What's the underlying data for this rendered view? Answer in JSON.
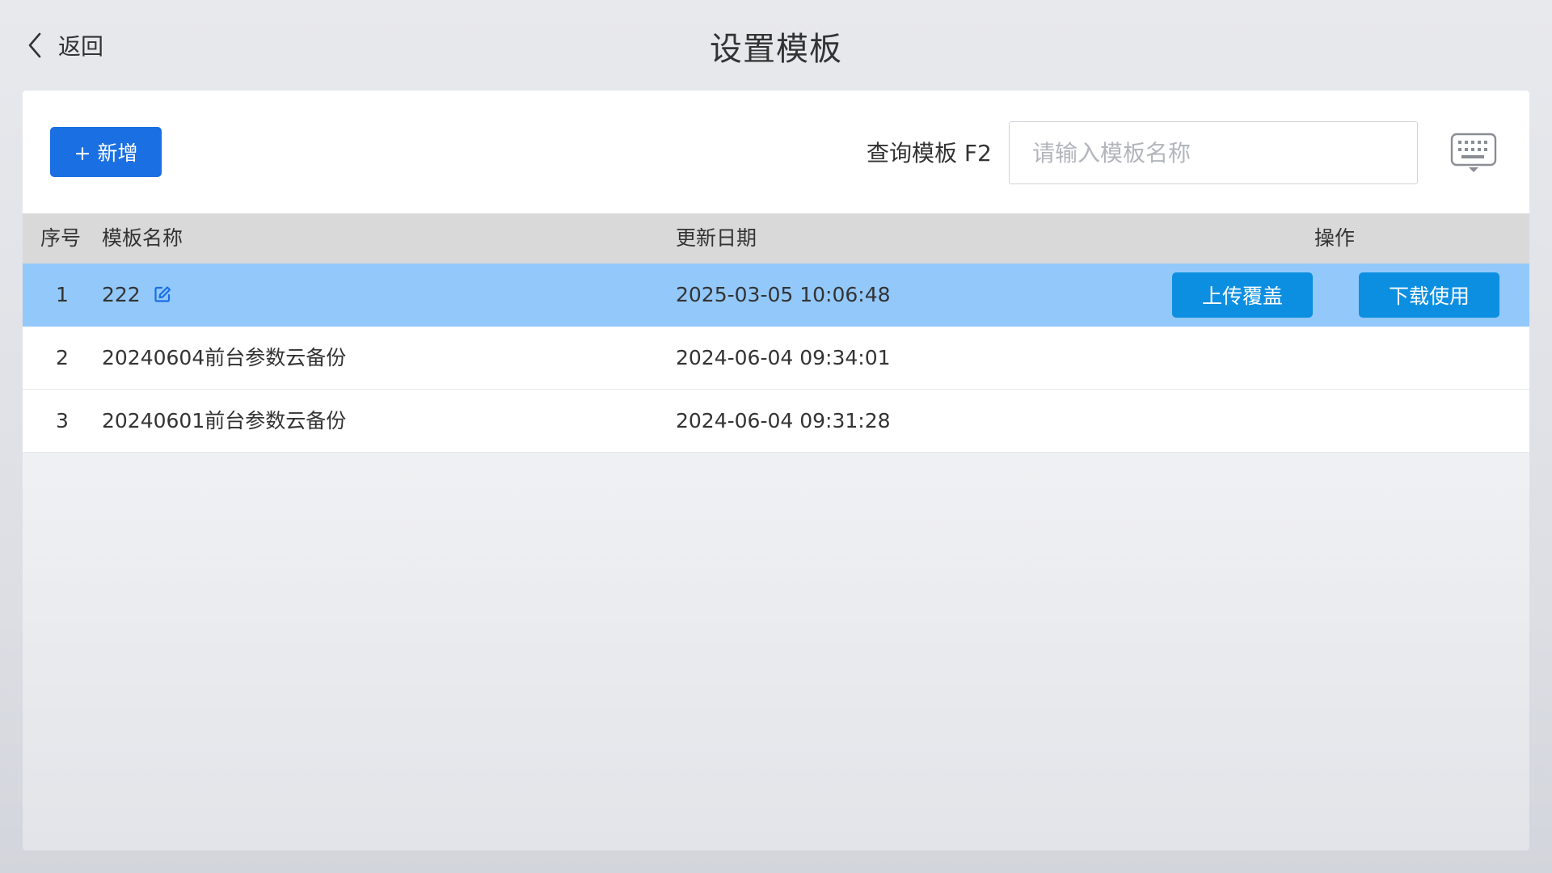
{
  "header": {
    "back_label": "返回",
    "title": "设置模板"
  },
  "toolbar": {
    "add_label": "+ 新增",
    "search_label": "查询模板 F2",
    "search_placeholder": "请输入模板名称",
    "search_value": "",
    "keyboard_icon": "keyboard-icon"
  },
  "table": {
    "columns": [
      "序号",
      "模板名称",
      "更新日期",
      "操作"
    ],
    "rows": [
      {
        "seq": "1",
        "name": "222",
        "date": "2025-03-05 10:06:48",
        "selected": true,
        "editable": true
      },
      {
        "seq": "2",
        "name": "20240604前台参数云备份",
        "date": "2024-06-04 09:34:01",
        "selected": false
      },
      {
        "seq": "3",
        "name": "20240601前台参数云备份",
        "date": "2024-06-04 09:31:28",
        "selected": false
      }
    ],
    "actions": {
      "upload_label": "上传覆盖",
      "download_label": "下载使用"
    }
  },
  "colors": {
    "primary": "#1a6fe2",
    "action": "#0d8fe1",
    "selected_row": "#93c8fb",
    "header_bg": "#d9d9d9"
  }
}
